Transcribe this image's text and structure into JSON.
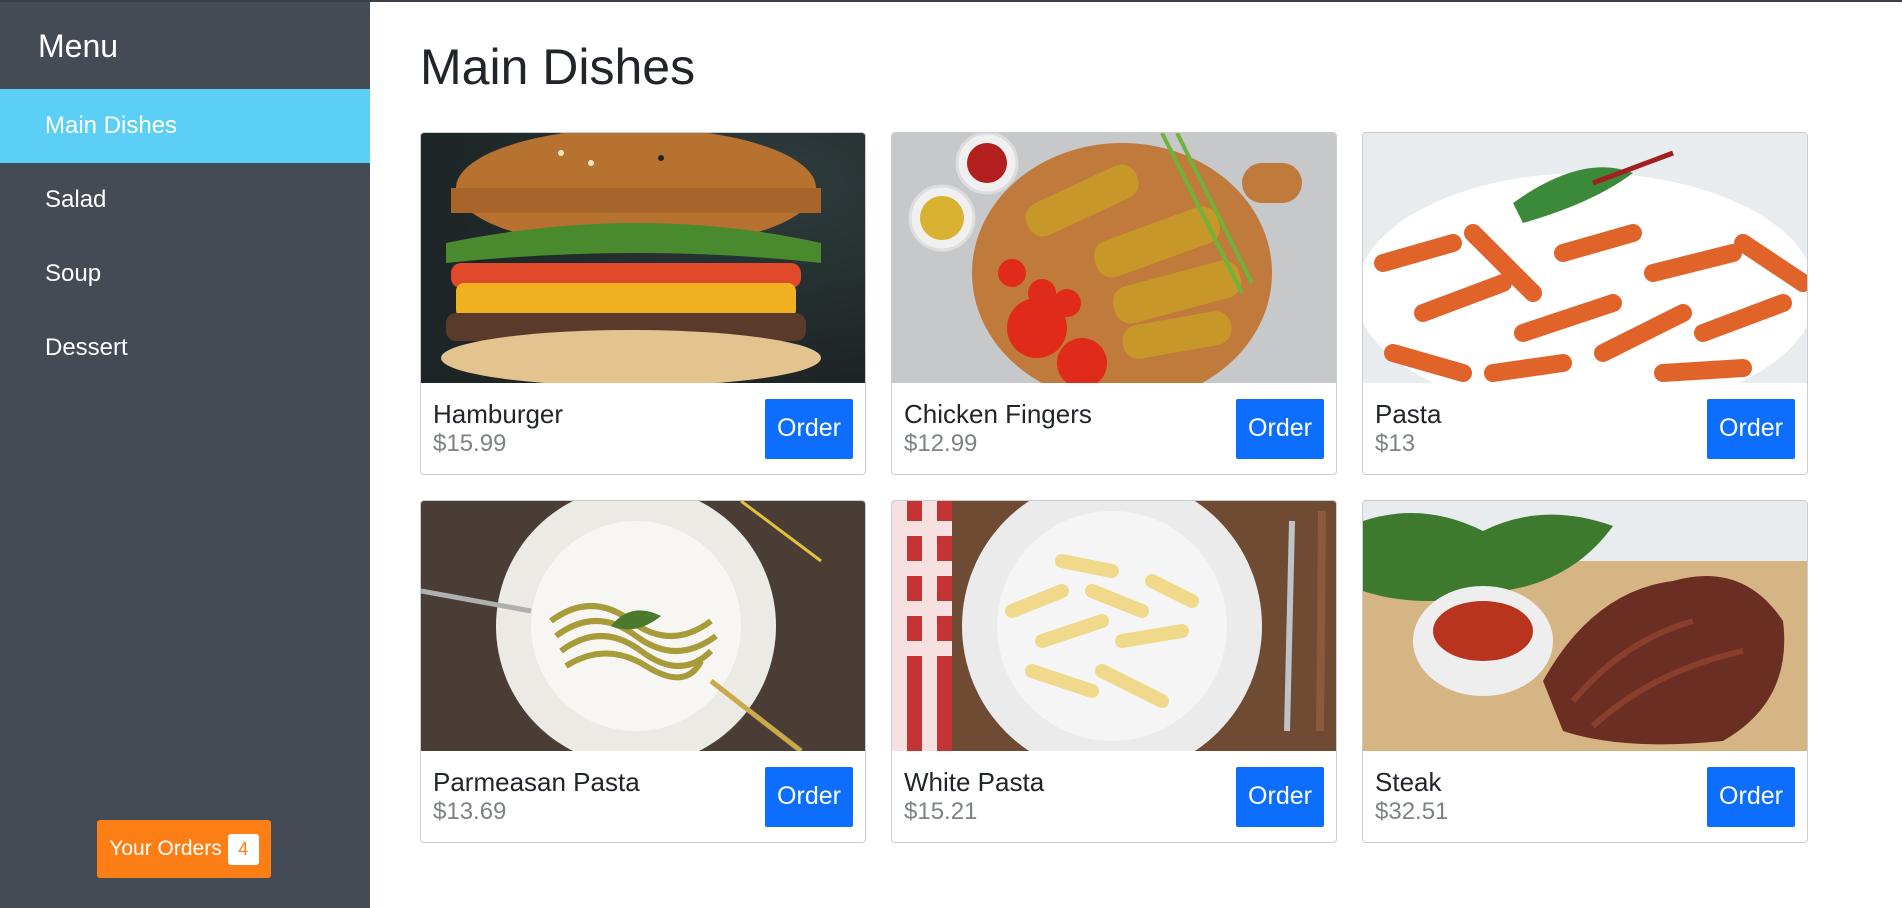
{
  "sidebar": {
    "title": "Menu",
    "items": [
      {
        "label": "Main Dishes",
        "active": true
      },
      {
        "label": "Salad",
        "active": false
      },
      {
        "label": "Soup",
        "active": false
      },
      {
        "label": "Dessert",
        "active": false
      }
    ],
    "orders_button": {
      "label": "Your Orders",
      "count": "4"
    }
  },
  "main": {
    "title": "Main Dishes",
    "dishes": [
      {
        "name": "Hamburger",
        "price": "$15.99",
        "button": "Order",
        "image": "hamburger"
      },
      {
        "name": "Chicken Fingers",
        "price": "$12.99",
        "button": "Order",
        "image": "chicken-fingers"
      },
      {
        "name": "Pasta",
        "price": "$13",
        "button": "Order",
        "image": "pasta"
      },
      {
        "name": "Parmeasan Pasta",
        "price": "$13.69",
        "button": "Order",
        "image": "parmesan-pasta"
      },
      {
        "name": "White Pasta",
        "price": "$15.21",
        "button": "Order",
        "image": "white-pasta"
      },
      {
        "name": "Steak",
        "price": "$32.51",
        "button": "Order",
        "image": "steak"
      }
    ]
  },
  "colors": {
    "sidebar_bg": "#454b55",
    "active_item": "#5bcff5",
    "order_button": "#0d6efd",
    "orders_badge": "#fd7e14"
  }
}
